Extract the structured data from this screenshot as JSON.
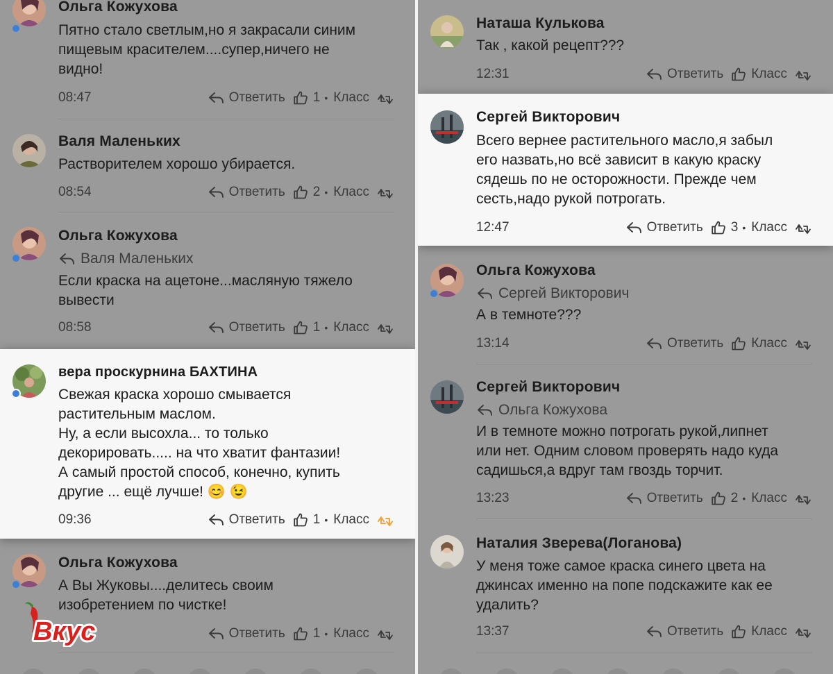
{
  "labels": {
    "reply": "Ответить",
    "like": "Класс",
    "bullet": "•"
  },
  "logo": {
    "text": "Вкус"
  },
  "left": [
    {
      "name": "Ольга Кожухова",
      "text": "Пятно стало светлым,но я закрасали синим\nпищевым красителем....супер,ничего не\nвидно!",
      "time": "08:47",
      "likes": "1",
      "highlight": false
    },
    {
      "name": "Валя Маленьких",
      "text": "Растворителем хорошо убирается.",
      "time": "08:54",
      "likes": "2",
      "highlight": false
    },
    {
      "name": "Ольга Кожухова",
      "reply_to": "Валя Маленьких",
      "text": "Если краска на ацетоне...масляную тяжело\nвывести",
      "time": "08:58",
      "likes": "1",
      "highlight": false
    },
    {
      "name": "вера проскурнина БАХТИНА",
      "text": "Свежая краска хорошо смывается\nрастительным маслом.\nНу, а если высохла... то только\nдекорировать..... на что хватит фантазии!\nА самый простой способ, конечно, купить\nдругие ... ещё лучше! 😊 😉",
      "time": "09:36",
      "likes": "1",
      "highlight": true,
      "liked": true
    },
    {
      "name": "Ольга Кожухова",
      "text": "А Вы Жуковы....делитесь своим\nизобретением по чистке!",
      "time": "",
      "likes": "1",
      "highlight": false
    }
  ],
  "right": [
    {
      "name": "Наташа Кулькова",
      "text": "Так , какой рецепт???",
      "time": "12:31",
      "likes": "",
      "highlight": false
    },
    {
      "name": "Сергей Викторович",
      "text": "Всего вернее растительного масло,я забыл\nего назвать,но всё зависит в какую краску\nсядешь по не осторожности. Прежде чем\nсесть,надо рукой потрогать.",
      "time": "12:47",
      "likes": "3",
      "highlight": true
    },
    {
      "name": "Ольга Кожухова",
      "reply_to": "Сергей Викторович",
      "text": "А в темноте???",
      "time": "13:14",
      "likes": "",
      "highlight": false
    },
    {
      "name": "Сергей Викторович",
      "reply_to": "Ольга Кожухова",
      "text": "И в темноте можно потрогать рукой,липнет\nили нет. Одним словом проверять надо куда\nсадишься,а вдруг там гвоздь торчит.",
      "time": "13:23",
      "likes": "2",
      "highlight": false
    },
    {
      "name": "Наталия Зверева(Логанова)",
      "text": "У меня тоже самое краска синего цвета на\nджинсах именно на попе подскажите как ее\nудалить?",
      "time": "13:37",
      "likes": "",
      "highlight": false
    }
  ],
  "colors": {
    "background": "#9a9a9a",
    "highlight": "#f7f7f7",
    "online_dot": "#3d7fd6",
    "liked": "#f0a43a",
    "logo_red": "#d8201c"
  }
}
